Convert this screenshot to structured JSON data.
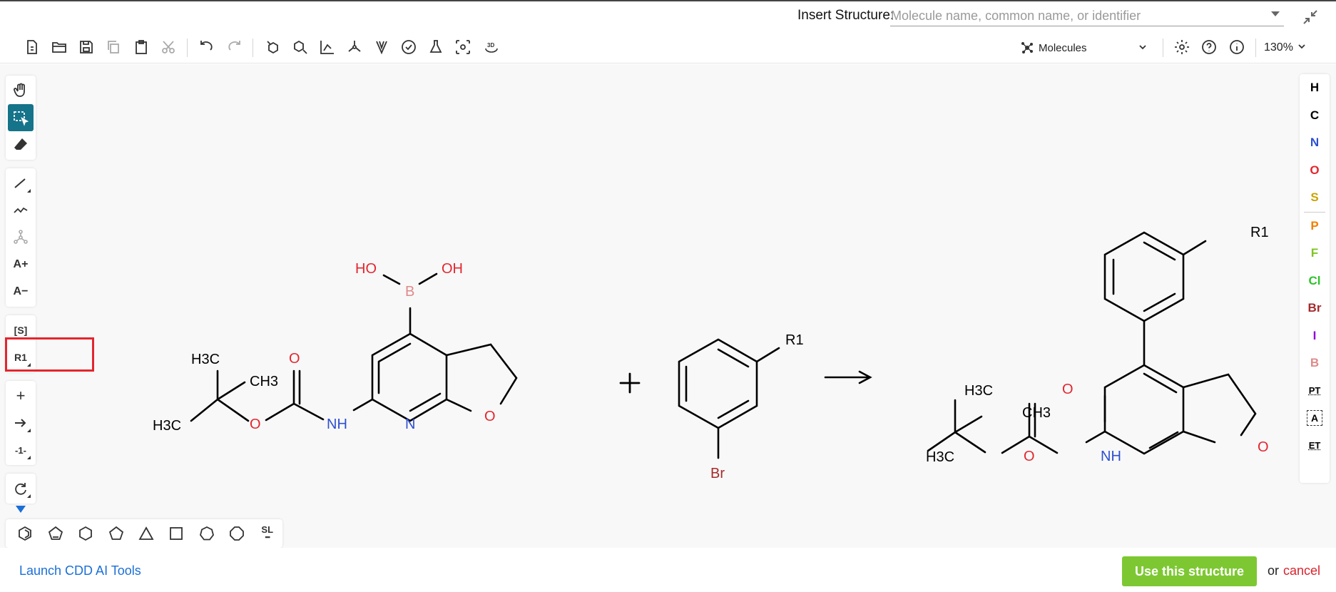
{
  "insert_structure": {
    "label": "Insert Structure:",
    "placeholder": "Molecule name, common name, or identifier"
  },
  "toolbar": {
    "icons": [
      "new-document-icon",
      "open-folder-icon",
      "save-icon",
      "copy-icon",
      "paste-icon",
      "cut-icon",
      "undo-icon",
      "redo-icon",
      "clean-icon",
      "aromatize-icon",
      "layout-icon",
      "stereo-icon",
      "chirality-icon",
      "check-icon",
      "flask-icon",
      "calculate-icon",
      "3d-icon",
      "3d-rotate-icon"
    ],
    "mode_label": "Molecules",
    "zoom_label": "130%"
  },
  "left_tools": {
    "hand": "hand-icon",
    "select": "select-lasso-icon",
    "erase": "eraser-icon",
    "bond": "single-bond-icon",
    "chain": "chain-icon",
    "atom": "atom-icon",
    "charge_plus_label": "A+",
    "charge_minus_label": "A−",
    "sgroup_label": "[S]",
    "rgroup_label": "R1",
    "plus_label": "+",
    "arrow": "reaction-arrow-icon",
    "mapping_label": "-1-",
    "rotate": "rotate-icon"
  },
  "shape_templates": [
    "benzene",
    "cyclopentadiene",
    "cyclohexane",
    "cyclopentane",
    "cyclopropane",
    "cyclobutane",
    "cycloheptane",
    "cyclooctane",
    "SL"
  ],
  "elements": [
    {
      "symbol": "H",
      "color": "#000000"
    },
    {
      "symbol": "C",
      "color": "#000000"
    },
    {
      "symbol": "N",
      "color": "#2e4fd1"
    },
    {
      "symbol": "O",
      "color": "#e3262e"
    },
    {
      "symbol": "S",
      "color": "#c8a400"
    },
    {
      "symbol": "P",
      "color": "#f08000"
    },
    {
      "symbol": "F",
      "color": "#7fc423"
    },
    {
      "symbol": "Cl",
      "color": "#2bc42b"
    },
    {
      "symbol": "Br",
      "color": "#a52a2a"
    },
    {
      "symbol": "I",
      "color": "#9400d3"
    },
    {
      "symbol": "B",
      "color": "#e08a8a"
    },
    {
      "symbol": "PT",
      "color": "#000000"
    },
    {
      "symbol": "A",
      "color": "#000000"
    },
    {
      "symbol": "ET",
      "color": "#000000"
    }
  ],
  "structure": {
    "reactant1_labels": {
      "ho": "HO",
      "oh": "OH",
      "b": "B",
      "h3c_top": "H3C",
      "ch3": "CH3",
      "h3c_bottom": "H3C",
      "o_carbonyl": "O",
      "o_ester": "O",
      "nh": "NH",
      "n": "N",
      "o_ring": "O"
    },
    "plus_sign": "+",
    "reactant2_labels": {
      "r1": "R1",
      "br": "Br"
    },
    "product_labels": {
      "r1": "R1",
      "h3c_top": "H3C",
      "ch3": "CH3",
      "h3c_bottom": "H3C",
      "o_carbonyl": "O",
      "o_ester": "O",
      "nh": "NH",
      "o_ring": "O"
    }
  },
  "footer": {
    "cdd_link": "Launch CDD AI Tools",
    "use_button": "Use this structure",
    "or_text": "or",
    "cancel_link": "cancel"
  }
}
